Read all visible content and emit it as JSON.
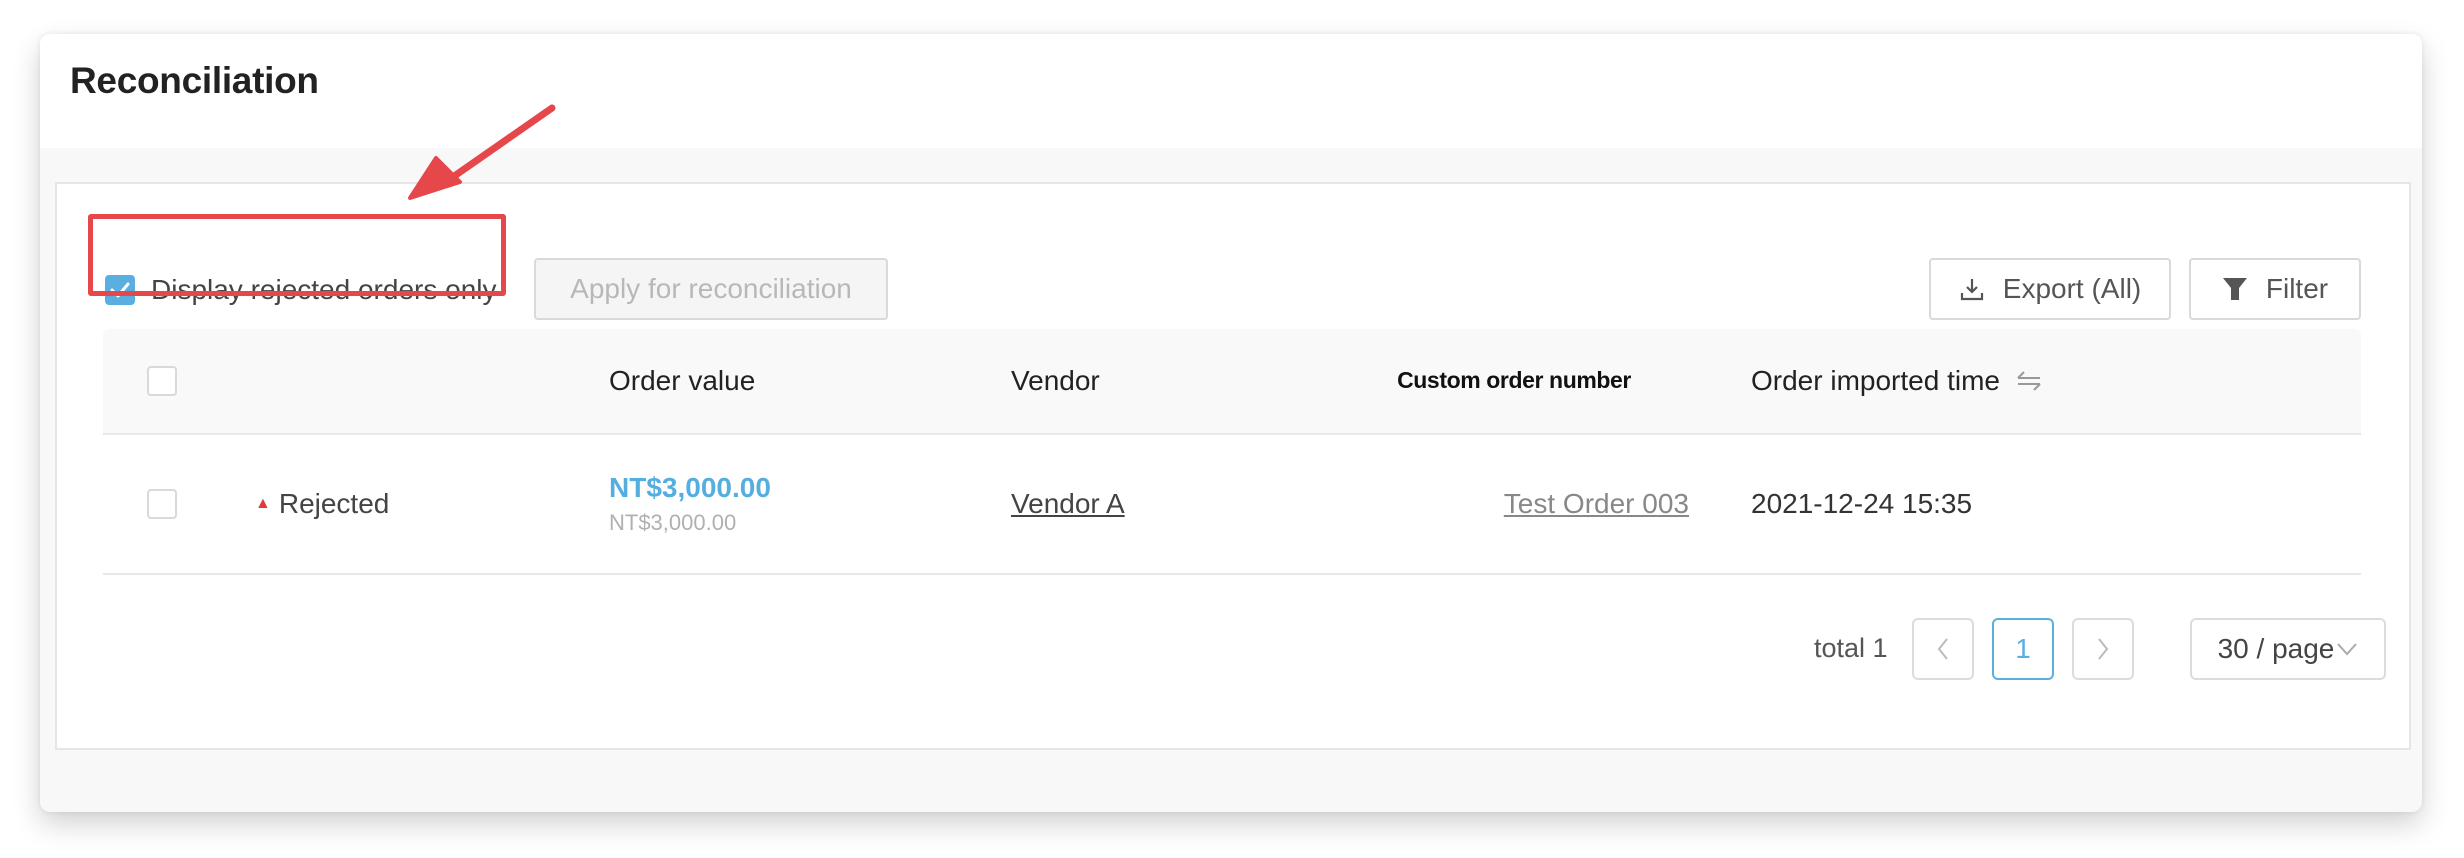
{
  "page": {
    "title": "Reconciliation"
  },
  "toolbar": {
    "rejected_only_label": "Display rejected orders only",
    "rejected_only_checked": true,
    "apply_label": "Apply for reconciliation",
    "export_label": "Export (All)",
    "filter_label": "Filter"
  },
  "table": {
    "columns": {
      "status": "",
      "order_value": "Order value",
      "vendor": "Vendor",
      "custom_order_number": "Custom order number",
      "imported_time": "Order imported time"
    },
    "rows": [
      {
        "status": "Rejected",
        "order_value": "NT$3,000.00",
        "order_value_sub": "NT$3,000.00",
        "vendor": "Vendor A",
        "custom_order_number": "Test Order 003",
        "imported_time": "2021-12-24 15:35"
      }
    ]
  },
  "pagination": {
    "total_label": "total 1",
    "prev": "<",
    "current_page": "1",
    "next": ">",
    "page_size": "30 / page"
  },
  "icons": {
    "checkbox": "check-icon",
    "export": "download-icon",
    "filter": "funnel-icon",
    "sort": "sort-arrows-icon",
    "status": "triangle-up-icon",
    "page_size": "chevron-down-icon"
  },
  "colors": {
    "accent": "#5aafe0",
    "annotation": "#e5474b",
    "rejected": "#e03a3a"
  }
}
